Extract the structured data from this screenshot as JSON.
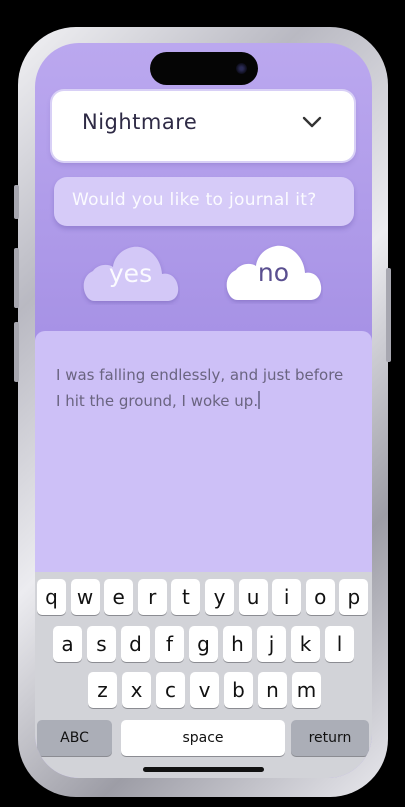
{
  "dream_type": {
    "selected": "Nightmare",
    "icon": "chevron-down-icon"
  },
  "prompt": {
    "text": "Would you like to journal it?"
  },
  "answers": {
    "yes_label": "yes",
    "no_label": "no"
  },
  "journal": {
    "text": "I was falling endlessly, and just before I hit the ground, I woke up."
  },
  "keyboard": {
    "rows": [
      [
        "q",
        "w",
        "e",
        "r",
        "t",
        "y",
        "u",
        "i",
        "o",
        "p"
      ],
      [
        "a",
        "s",
        "d",
        "f",
        "g",
        "h",
        "j",
        "k",
        "l"
      ],
      [
        "z",
        "x",
        "c",
        "v",
        "b",
        "n",
        "m"
      ]
    ],
    "abc_label": "ABC",
    "space_label": "space",
    "return_label": "return"
  },
  "colors": {
    "background_top": "#bba8ef",
    "background_bottom": "#9986dd",
    "journal_panel": "#cdc0f7",
    "selected_cloud": "#ffffff",
    "unselected_cloud": "#d3c8f7"
  }
}
